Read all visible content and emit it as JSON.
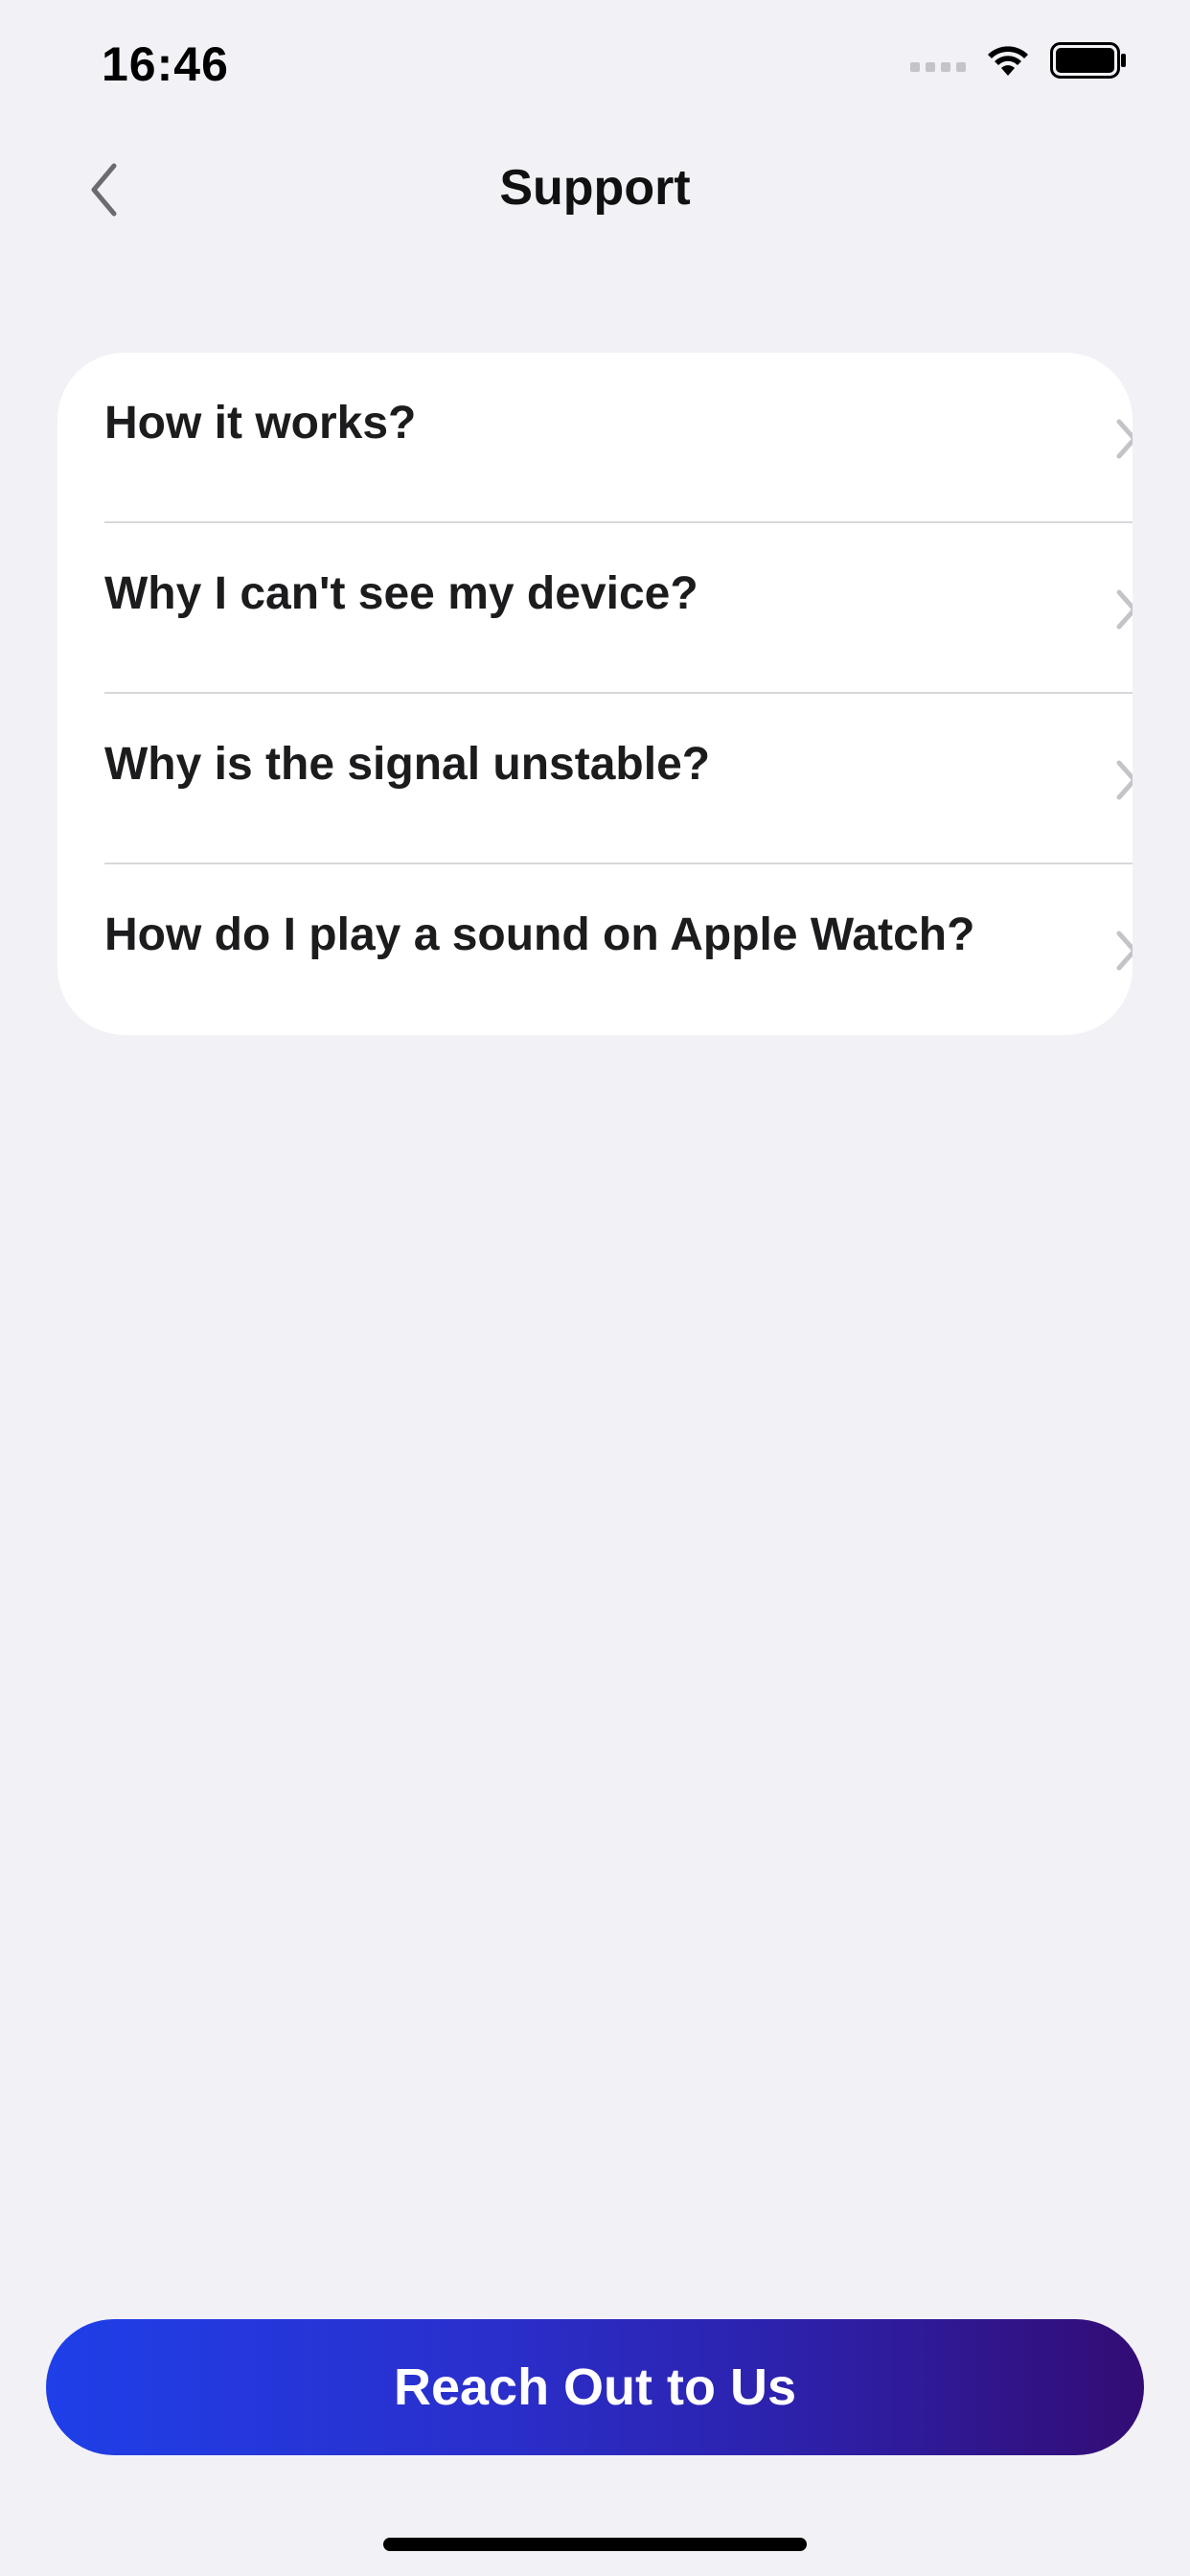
{
  "status_bar": {
    "time": "16:46",
    "icons": [
      "cellular-signal-icon",
      "wifi-icon",
      "battery-icon"
    ]
  },
  "nav": {
    "back_icon": "chevron-left-icon",
    "title": "Support"
  },
  "faq": {
    "items": [
      {
        "label": "How it works?"
      },
      {
        "label": "Why I can't see my device?"
      },
      {
        "label": "Why is the signal unstable?"
      },
      {
        "label": "How do I play a sound on Apple Watch?"
      }
    ],
    "row_icon": "chevron-right-icon"
  },
  "cta": {
    "label": "Reach Out to Us",
    "gradient_start": "#1f3fe8",
    "gradient_end": "#330c74"
  },
  "colors": {
    "background": "#f2f1f6",
    "card": "#ffffff",
    "chevron": "#c4c4c8"
  }
}
